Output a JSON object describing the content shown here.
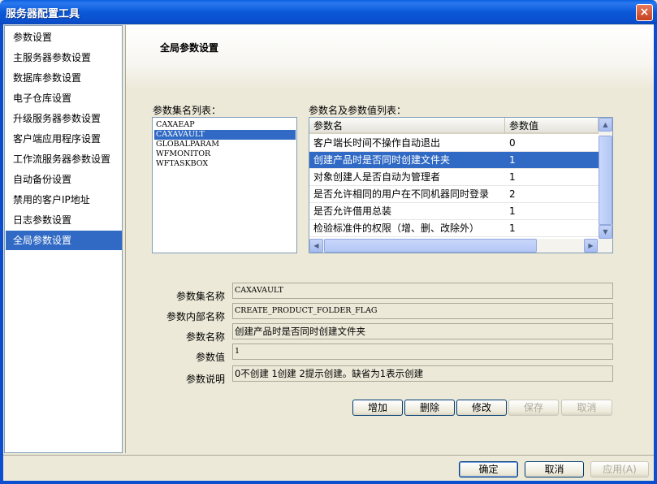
{
  "window": {
    "title": "服务器配置工具",
    "close_label": "×"
  },
  "sidebar": {
    "items": [
      {
        "label": "参数设置",
        "selected": false
      },
      {
        "label": "主服务器参数设置",
        "selected": false
      },
      {
        "label": "数据库参数设置",
        "selected": false
      },
      {
        "label": "电子仓库设置",
        "selected": false
      },
      {
        "label": "升级服务器参数设置",
        "selected": false
      },
      {
        "label": "客户端应用程序设置",
        "selected": false
      },
      {
        "label": "工作流服务器参数设置",
        "selected": false
      },
      {
        "label": "自动备份设置",
        "selected": false
      },
      {
        "label": "禁用的客户IP地址",
        "selected": false
      },
      {
        "label": "日志参数设置",
        "selected": false
      },
      {
        "label": "全局参数设置",
        "selected": true
      }
    ]
  },
  "main": {
    "title": "全局参数设置",
    "set_list_label": "参数集名列表：",
    "set_list": [
      "CAXAEAP",
      "CAXAVAULT",
      "GLOBALPARAM",
      "WFMONITOR",
      "WFTASKBOX"
    ],
    "set_selected_index": 1,
    "grid_label": "参数名及参数值列表：",
    "grid": {
      "headers": [
        "参数名",
        "参数值"
      ],
      "rows": [
        {
          "name": "客户端长时间不操作自动退出",
          "value": "0"
        },
        {
          "name": "创建产品时是否同时创建文件夹",
          "value": "1"
        },
        {
          "name": "对象创建人是否自动为管理者",
          "value": "1"
        },
        {
          "name": "是否允许相同的用户在不同机器同时登录",
          "value": "2"
        },
        {
          "name": "是否允许借用总装",
          "value": "1"
        },
        {
          "name": "检验标准件的权限（增、删、改除外）",
          "value": "1"
        }
      ],
      "selected_index": 1
    },
    "details": {
      "set_name_label": "参数集名称",
      "set_name": "CAXAVAULT",
      "internal_name_label": "参数内部名称",
      "internal_name": "CREATE_PRODUCT_FOLDER_FLAG",
      "param_name_label": "参数名称",
      "param_name": "创建产品时是否同时创建文件夹",
      "value_label": "参数值",
      "value": "1",
      "desc_label": "参数说明",
      "desc": "0不创建 1创建 2提示创建。缺省为1表示创建"
    },
    "actions": {
      "add": "增加",
      "delete": "删除",
      "modify": "修改",
      "save": "保存",
      "cancel": "取消"
    }
  },
  "footer": {
    "ok": "确定",
    "cancel": "取消",
    "apply": "应用(A)"
  }
}
